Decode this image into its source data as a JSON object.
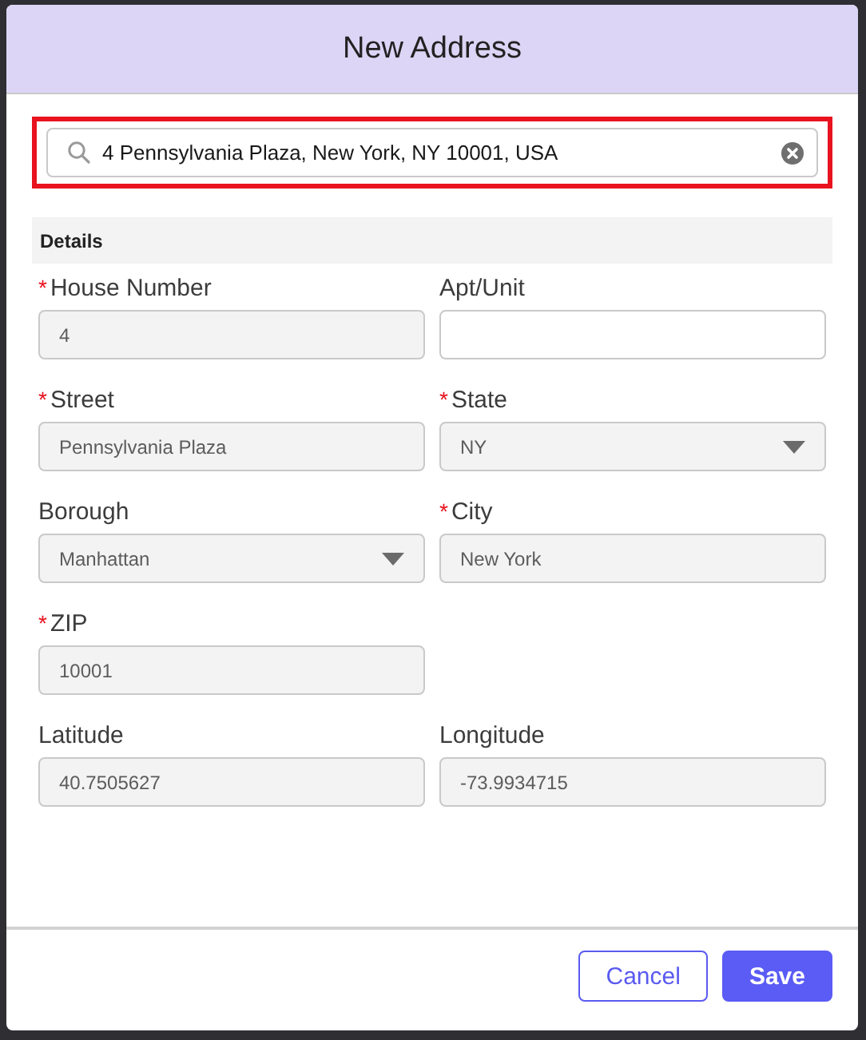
{
  "dialog": {
    "title": "New Address"
  },
  "search": {
    "value": "4 Pennsylvania Plaza, New York, NY 10001, USA",
    "highlighted": true
  },
  "section": {
    "title": "Details"
  },
  "rows": [
    [
      {
        "marker": "*",
        "label": "House Number",
        "kind": "text",
        "disabled": true,
        "value": "4"
      },
      {
        "label": "Apt/Unit",
        "kind": "text",
        "disabled": false
      }
    ],
    [
      {
        "marker": "*",
        "label": "Street",
        "kind": "text",
        "disabled": true,
        "value": "Pennsylvania Plaza"
      },
      {
        "marker": "*",
        "label": "State",
        "kind": "select",
        "disabled": true,
        "value": "NY"
      }
    ],
    [
      {
        "label": "Borough",
        "kind": "select",
        "disabled": true,
        "value": "Manhattan"
      },
      {
        "marker": "*",
        "label": "City",
        "kind": "text",
        "disabled": true,
        "value": "New York"
      }
    ],
    [
      {
        "marker": "*",
        "label": "ZIP",
        "kind": "text",
        "disabled": true,
        "value": "10001"
      }
    ],
    [
      {
        "label": "Latitude",
        "kind": "text",
        "disabled": true,
        "value": "40.7505627"
      },
      {
        "label": "Longitude",
        "kind": "text",
        "disabled": true,
        "value": "-73.9934715"
      }
    ]
  ],
  "buttons": [
    {
      "label": "Cancel",
      "kind": "secondary"
    },
    {
      "label": "Save",
      "kind": "primary"
    }
  ]
}
